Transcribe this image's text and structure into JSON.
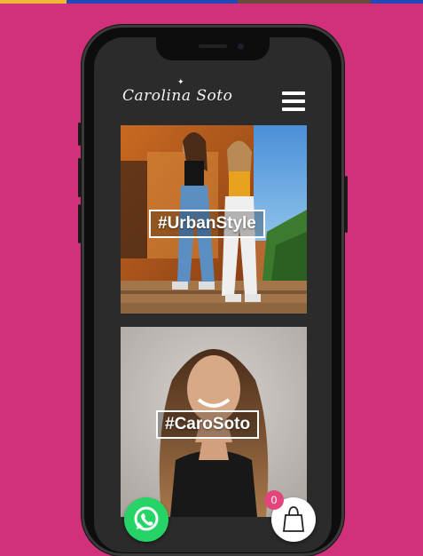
{
  "header": {
    "logo_text": "Carolina Soto",
    "menu_icon": "hamburger-menu-icon"
  },
  "cards": [
    {
      "hashtag": "#UrbanStyle",
      "image": "two-women-urban-outdoor-photo"
    },
    {
      "hashtag": "#CaroSoto",
      "image": "woman-portrait-long-hair-photo"
    }
  ],
  "floating": {
    "whatsapp_icon": "whatsapp-icon",
    "cart_icon": "shopping-bag-icon",
    "cart_count": "0"
  },
  "colors": {
    "page_background": "#d1307a",
    "screen_background": "#2b2b2b",
    "whatsapp": "#25d366",
    "cart_badge": "#e0457b"
  }
}
